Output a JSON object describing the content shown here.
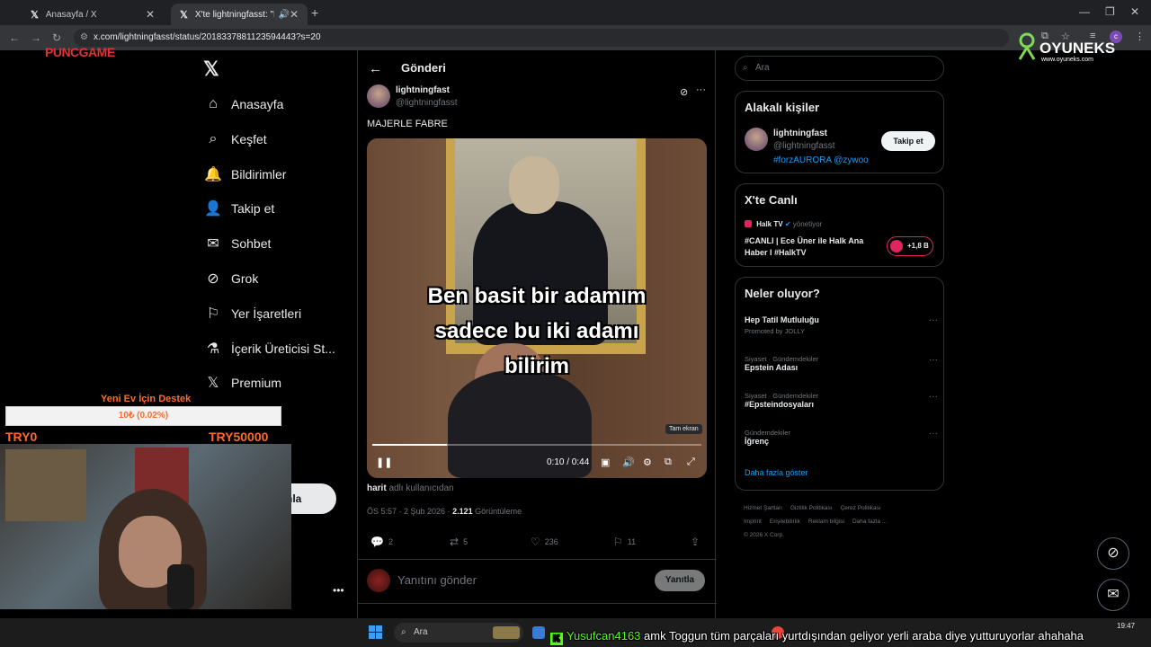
{
  "browser": {
    "tabs": [
      {
        "title": "Anasayfa / X"
      },
      {
        "title": "X'te lightningfasst: \"MAJERL"
      }
    ],
    "url": "x.com/lightningfasst/status/2018337881123594443?s=20"
  },
  "overlays": {
    "left_logo": "PUNCGAME",
    "right_brand": "OYUNEKS",
    "right_site": "www.oyuneks.com",
    "donate_title": "Yeni Ev İçin Destek",
    "donate_progress": "10₺ (0.02%)",
    "donate_fraction": 0.0002,
    "donate_min": "TRY0",
    "donate_max": "TRY50000",
    "partial_button": "nla"
  },
  "nav": {
    "items": [
      {
        "label": "Anasayfa",
        "icon": "home-icon"
      },
      {
        "label": "Keşfet",
        "icon": "search-icon"
      },
      {
        "label": "Bildirimler",
        "icon": "bell-icon"
      },
      {
        "label": "Takip et",
        "icon": "follow-icon"
      },
      {
        "label": "Sohbet",
        "icon": "mail-icon"
      },
      {
        "label": "Grok",
        "icon": "grok-icon"
      },
      {
        "label": "Yer İşaretleri",
        "icon": "bookmark-icon"
      },
      {
        "label": "İçerik Üreticisi St...",
        "icon": "flask-icon"
      },
      {
        "label": "Premium",
        "icon": "x-icon"
      }
    ]
  },
  "post": {
    "header_title": "Gönderi",
    "author_name": "lightningfast",
    "author_handle": "@lightningfasst",
    "text": "MAJERLE FABRE",
    "video": {
      "caption_lines": [
        "Ben basit bir adamım",
        "sadece bu iki adamı",
        "bilirim"
      ],
      "tooltip": "Tam ekran",
      "time": "0:10 / 0:44",
      "progress": 0.227
    },
    "from_user": "harit",
    "from_suffix": "adlı kullanıcıdan",
    "timestamp": "ÖS 5:57 · 2 Şub 2026 ·",
    "views": "2.121",
    "views_label": "Görüntüleme",
    "replies": "2",
    "reposts": "5",
    "likes": "236",
    "bookmarks": "11",
    "reply_placeholder": "Yanıtını gönder",
    "reply_button": "Yanıtla"
  },
  "sidebar": {
    "search_placeholder": "Ara",
    "relevant": {
      "title": "Alakalı kişiler",
      "name": "lightningfast",
      "handle": "@lightningfasst",
      "bio": "#forzAURORA @zywoo",
      "follow_label": "Takip et"
    },
    "live": {
      "title": "X'te Canlı",
      "source": "Halk TV",
      "status": "yönetiyor",
      "headline": "#CANLI | Ece Üner ile Halk Ana Haber I #HalkTV",
      "listeners": "+1,8 B"
    },
    "trends": {
      "title": "Neler oluyor?",
      "items": [
        {
          "name": "Hep Tatil Mutluluğu",
          "context": "Promoted by JOLLY"
        },
        {
          "context": "Siyaset · Gündemdekiler",
          "name": "Epstein Adası"
        },
        {
          "context": "Siyaset · Gündemdekiler",
          "name": "#Epsteindosyaları"
        },
        {
          "context": "Gündemdekiler",
          "name": "İğrenç"
        }
      ],
      "show_more": "Daha fazla göster"
    },
    "footer": [
      "Hizmet Şartları",
      "Gizlilik Politikası",
      "Çerez Politikası",
      "Imprint",
      "Erişilebilirlik",
      "Reklam bilgisi",
      "Daha fazla ...",
      "© 2026 X Corp."
    ]
  },
  "taskbar": {
    "search_placeholder": "Ara",
    "clock": "19:47"
  },
  "chat": {
    "user": "Yusufcan4163",
    "message": "amk Toggun tüm parçaları yurtdışından geliyor yerli araba diye yutturuyorlar ahahaha"
  }
}
